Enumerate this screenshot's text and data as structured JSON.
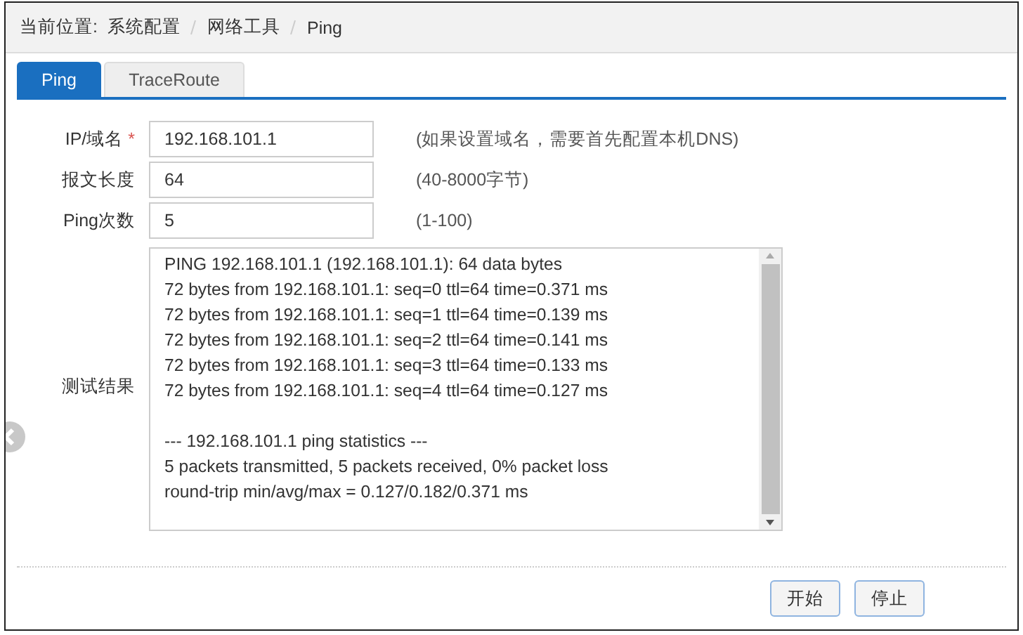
{
  "breadcrumb": {
    "label": "当前位置:",
    "items": [
      "系统配置",
      "网络工具",
      "Ping"
    ]
  },
  "tabs": [
    {
      "label": "Ping",
      "selected": true
    },
    {
      "label": "TraceRoute",
      "selected": false
    }
  ],
  "required_marker": "*",
  "fields": [
    {
      "label": "IP/域名",
      "required": true,
      "value": "192.168.101.1",
      "hint": "(如果设置域名，需要首先配置本机DNS)"
    },
    {
      "label": "报文长度",
      "required": false,
      "value": "64",
      "hint": "(40-8000字节)"
    },
    {
      "label": "Ping次数",
      "required": false,
      "value": "5",
      "hint": "(1-100)"
    }
  ],
  "result": {
    "label": "测试结果",
    "blocks": [
      [
        "PING 192.168.101.1 (192.168.101.1): 64 data bytes",
        "72 bytes from 192.168.101.1: seq=0 ttl=64 time=0.371 ms",
        "72 bytes from 192.168.101.1: seq=1 ttl=64 time=0.139 ms",
        "72 bytes from 192.168.101.1: seq=2 ttl=64 time=0.141 ms",
        "72 bytes from 192.168.101.1: seq=3 ttl=64 time=0.133 ms",
        "72 bytes from 192.168.101.1: seq=4 ttl=64 time=0.127 ms"
      ],
      [
        "--- 192.168.101.1 ping statistics ---",
        "5 packets transmitted, 5 packets received, 0% packet loss",
        "round-trip min/avg/max = 0.127/0.182/0.371 ms"
      ]
    ]
  },
  "buttons": [
    "开始",
    "停止"
  ]
}
